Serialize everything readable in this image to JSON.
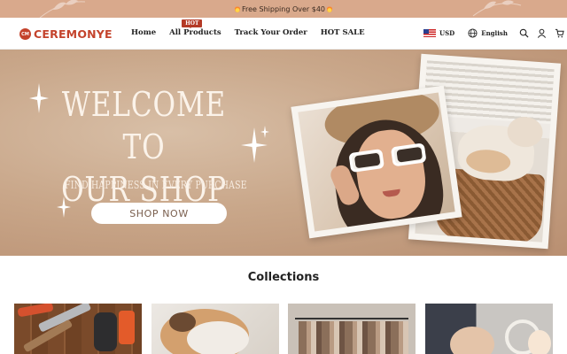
{
  "announcement": {
    "text": "Free Shipping Over $40"
  },
  "brand": {
    "name": "CEREMONYE",
    "mark": "CM",
    "color": "#c4432c"
  },
  "nav": {
    "items": [
      {
        "label": "Home"
      },
      {
        "label": "All Products",
        "badge": "HOT"
      },
      {
        "label": "Track Your Order"
      },
      {
        "label": "HOT SALE"
      }
    ]
  },
  "header_right": {
    "currency": "USD",
    "language": "English",
    "icons": [
      "search-icon",
      "account-icon",
      "cart-icon"
    ]
  },
  "hero": {
    "line1": "WELCOME TO",
    "line2": "OUR SHOP",
    "subtitle": "FIND HAPPINESS IN EVERY PURCHASE",
    "button_label": "SHOP NOW"
  },
  "collections": {
    "title": "Collections"
  },
  "colors": {
    "announcement_bg": "#d9a98c",
    "hero_bg": "#c9a78a",
    "badge": "#b43a26"
  }
}
